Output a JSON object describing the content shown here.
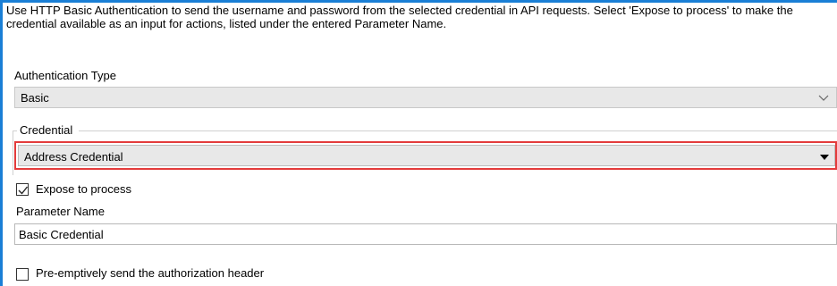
{
  "description": "Use HTTP Basic Authentication to send the username and password from the selected credential in API requests. Select 'Expose to process' to make the credential available as an input for actions, listed under the entered Parameter Name.",
  "auth_type": {
    "label": "Authentication Type",
    "value": "Basic",
    "icon": "chevron-down-icon"
  },
  "credential": {
    "group_label": "Credential",
    "value": "Address Credential",
    "icon": "dropdown-triangle-icon",
    "highlight_color": "#e33b3b"
  },
  "expose": {
    "label": "Expose to process",
    "checked": true
  },
  "parameter": {
    "label": "Parameter Name",
    "value": "Basic Credential"
  },
  "preemptive": {
    "label": "Pre-emptively send the authorization header",
    "checked": false
  },
  "colors": {
    "accent": "#1a7fd6",
    "control_bg": "#e8e8e8"
  }
}
